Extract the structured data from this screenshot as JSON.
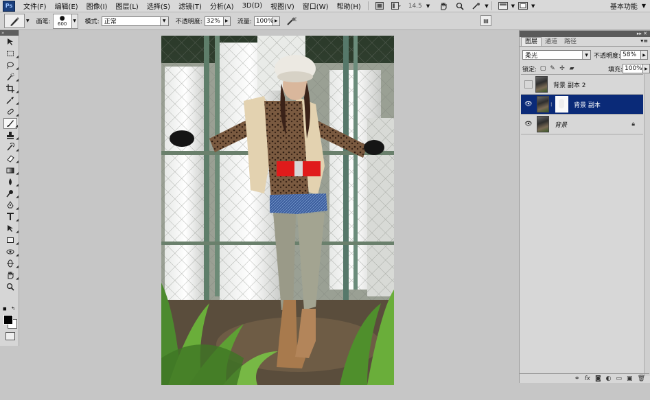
{
  "menubar": {
    "logo": "Ps",
    "items": [
      "文件(F)",
      "编辑(E)",
      "图像(I)",
      "图层(L)",
      "选择(S)",
      "滤镜(T)",
      "分析(A)",
      "3D(D)",
      "视图(V)",
      "窗口(W)",
      "帮助(H)"
    ],
    "zoom": "14.5",
    "workspace": "基本功能"
  },
  "options": {
    "brush_label": "画笔:",
    "brush_size": "600",
    "mode_label": "模式:",
    "mode_value": "正常",
    "opacity_label": "不透明度:",
    "opacity_value": "32%",
    "flow_label": "流量:",
    "flow_value": "100%"
  },
  "layers_panel": {
    "tabs": [
      "图层",
      "通道",
      "路径"
    ],
    "blend_mode": "柔光",
    "opacity_label": "不透明度:",
    "opacity_value": "58%",
    "lock_label": "锁定:",
    "fill_label": "填充:",
    "fill_value": "100%",
    "layers": [
      {
        "name": "背景 副本 2",
        "visible": false,
        "selected": false
      },
      {
        "name": "背景 副本",
        "visible": true,
        "selected": true
      },
      {
        "name": "背景",
        "visible": true,
        "selected": false,
        "locked": true
      }
    ]
  },
  "colors": {
    "selected_layer": "#0a2a78",
    "belt": "#e01b1b"
  }
}
